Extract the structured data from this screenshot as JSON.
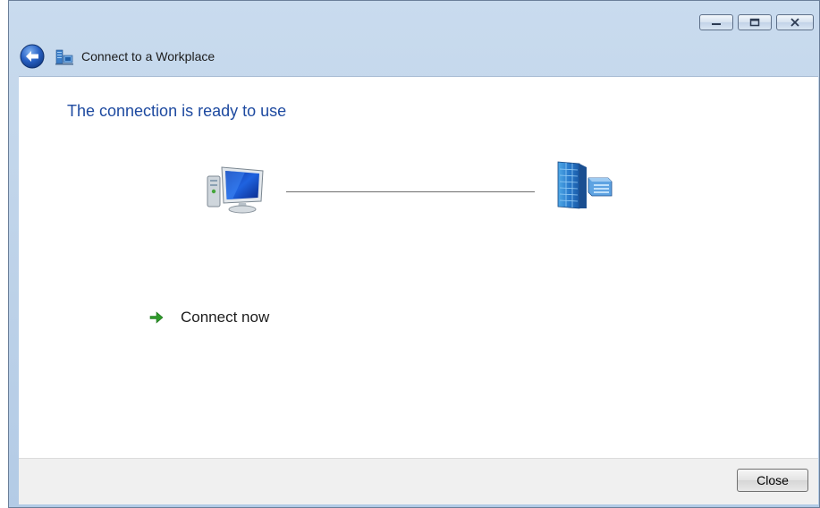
{
  "window": {
    "title": "Connect to a Workplace",
    "caption_buttons": {
      "minimize_icon": "minimize-icon",
      "maximize_icon": "maximize-icon",
      "close_icon": "close-icon"
    }
  },
  "content": {
    "heading": "The connection is ready to use",
    "left_icon": "computer-icon",
    "right_icon": "workplace-network-icon",
    "action_link": {
      "icon": "green-arrow-icon",
      "label": "Connect now"
    }
  },
  "footer": {
    "close_label": "Close"
  },
  "colors": {
    "heading": "#1e4aa0",
    "frame": "#c9dbee",
    "footer": "#f0f0f0"
  }
}
